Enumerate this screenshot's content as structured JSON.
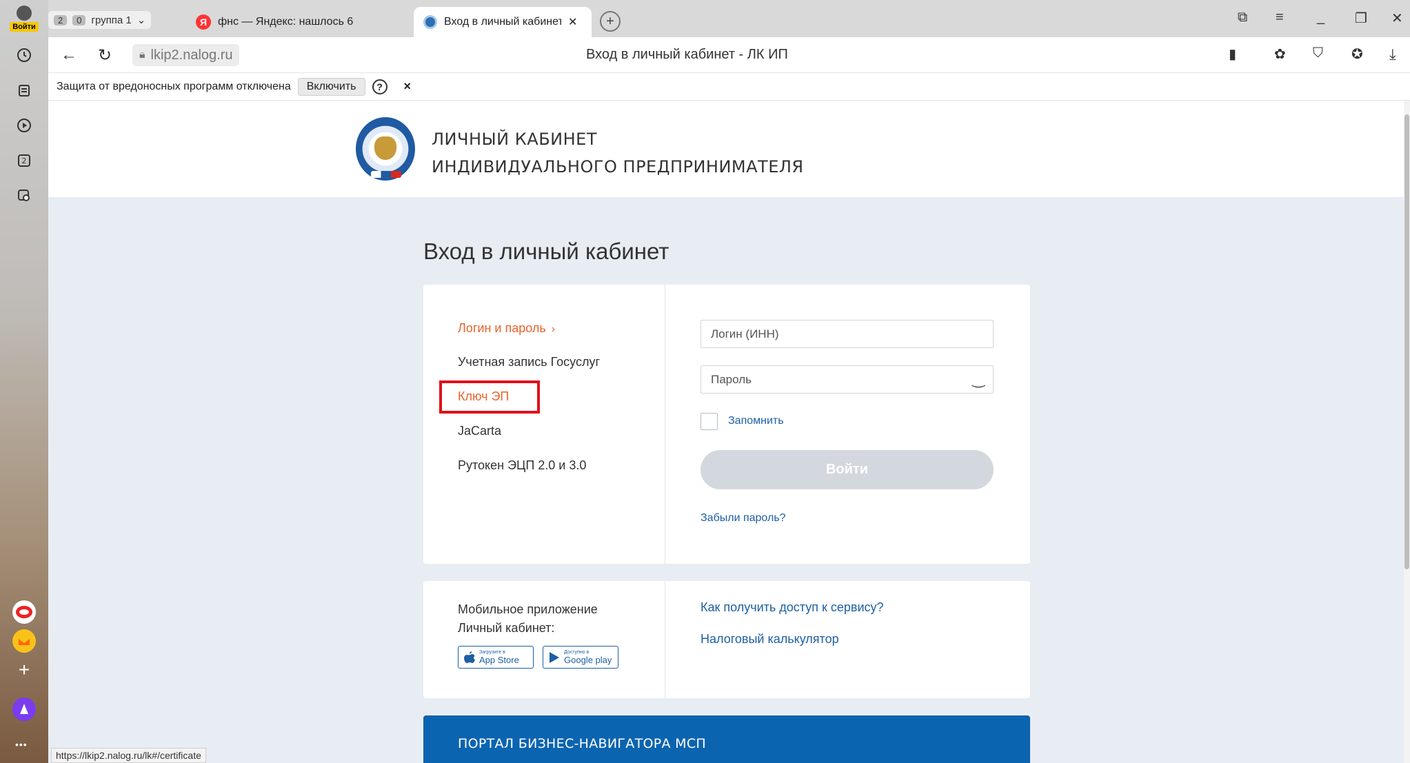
{
  "sidebar": {
    "login_label": "Войти"
  },
  "tabs": {
    "counter_a": "2",
    "counter_b": "0",
    "group_label": "группа 1",
    "tab1_title": "фнс — Яндекс: нашлось 6",
    "tab2_title": "Вход в личный кабинет",
    "yandex_letter": "Я"
  },
  "address": {
    "url": "lkip2.nalog.ru",
    "page_title": "Вход в личный кабинет - ЛК ИП"
  },
  "notice": {
    "text": "Защита от вредоносных программ отключена",
    "enable_label": "Включить",
    "help_label": "?",
    "close_label": "×"
  },
  "header": {
    "brand_line1": "ЛИЧНЫЙ КАБИНЕТ",
    "brand_line2": "ИНДИВИДУАЛЬНОГО ПРЕДПРИНИМАТЕЛЯ"
  },
  "login": {
    "heading": "Вход в личный кабинет",
    "methods": [
      "Логин и пароль",
      "Учетная запись Госуслуг",
      "Ключ ЭП",
      "JaCarta",
      "Рутокен ЭЦП 2.0 и 3.0"
    ],
    "login_placeholder": "Логин (ИНН)",
    "password_placeholder": "Пароль",
    "remember_label": "Запомнить",
    "submit_label": "Войти",
    "forgot_label": "Забыли пароль?"
  },
  "info": {
    "mobile_line1": "Мобильное приложение",
    "mobile_line2": "Личный кабинет:",
    "appstore_small": "Загрузите в",
    "appstore_big": "App Store",
    "googleplay_small": "Доступно в",
    "googleplay_big": "Google play",
    "link_access": "Как получить доступ к сервису?",
    "link_calc": "Налоговый калькулятор"
  },
  "banner": {
    "text": "ПОРТАЛ БИЗНЕС-НАВИГАТОРА МСП"
  },
  "status": {
    "url": "https://lkip2.nalog.ru/lk#/certificate"
  }
}
